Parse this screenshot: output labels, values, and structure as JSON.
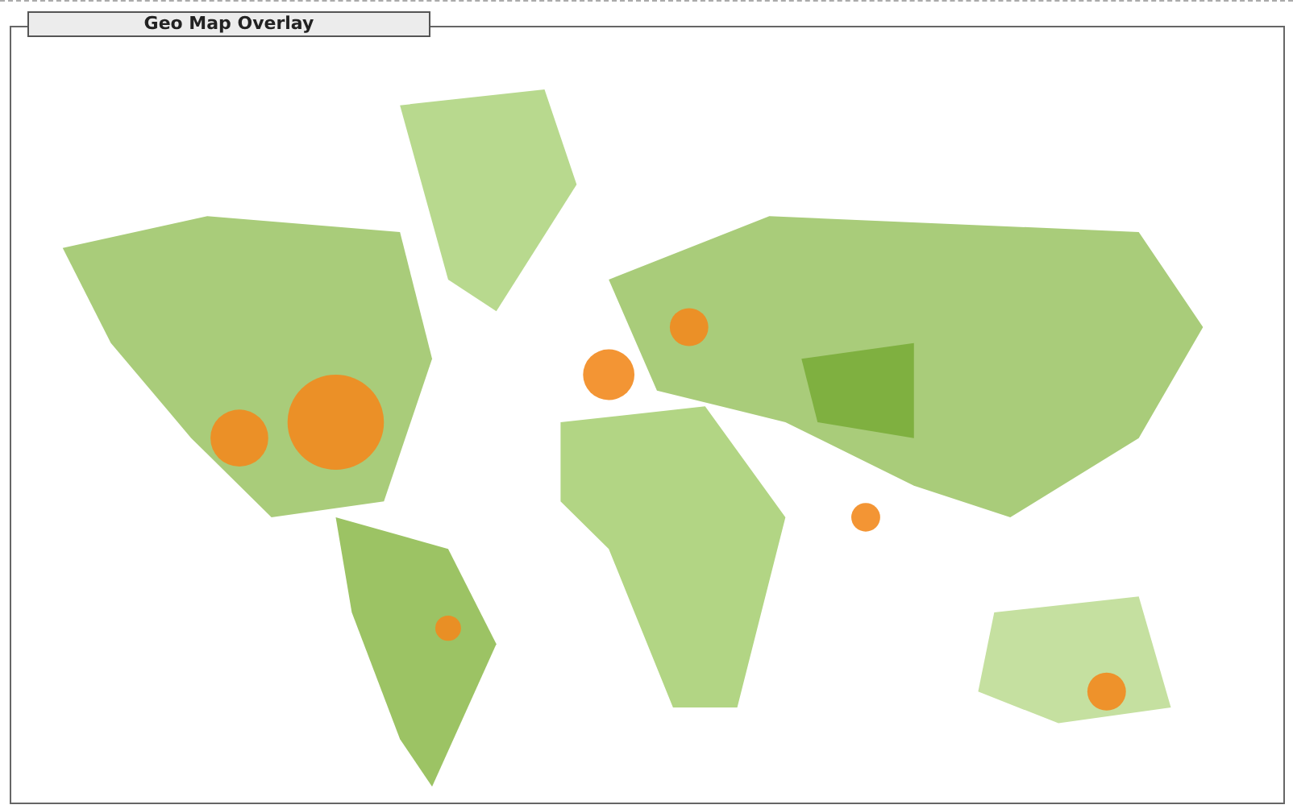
{
  "panel": {
    "title": "Geo Map Overlay"
  }
}
